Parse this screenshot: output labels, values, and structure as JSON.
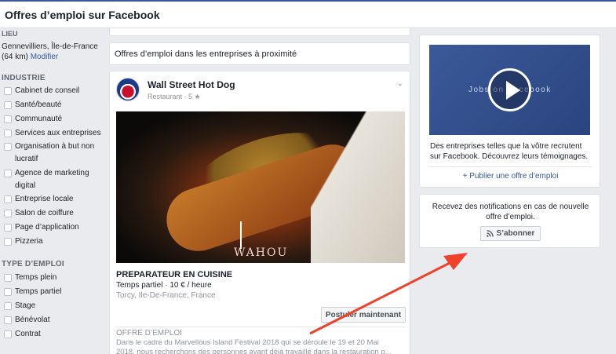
{
  "header": {
    "title": "Offres d’emploi sur Facebook"
  },
  "sidebar": {
    "location_heading": "LIEU",
    "location_text": "Gennevilliers, Île-de-France (64 km)",
    "location_link": "Modifier",
    "industry_heading": "INDUSTRIE",
    "industries": [
      "Cabinet de conseil",
      "Santé/beauté",
      "Communauté",
      "Services aux entreprises",
      "Organisation à but non lucratif",
      "Agence de marketing digital",
      "Entreprise locale",
      "Salon de coiffure",
      "Page d’application",
      "Pizzeria"
    ],
    "type_heading": "TYPE D’EMPLOI",
    "types": [
      "Temps plein",
      "Temps partiel",
      "Stage",
      "Bénévolat",
      "Contrat"
    ]
  },
  "main": {
    "nearby_heading": "Offres d’emploi dans les entreprises à proximité",
    "job": {
      "business_name": "Wall Street Hot Dog",
      "business_meta": "Restaurant · 5 ★",
      "image_watermark": "WAHOU",
      "title": "PREPARATEUR EN CUISINE",
      "meta": "Temps partiel · 10 € / heure",
      "location": "Torcy, Ile-De-France, France",
      "apply_label": "Postuler maintenant",
      "offer_heading": "OFFRE D’EMPLOI",
      "offer_text": "Dans le cadre du Marvellous Island Festival 2018 qui se déroule le 19 et 20 Mai 2018, nous recherchons des personnes ayant déjà travaillé dans la restauration p..."
    }
  },
  "right": {
    "video_overlay": "Jobs on Facebook",
    "promo_text": "Des entreprises telles que la vôtre recrutent sur Facebook. Découvrez leurs témoignages.",
    "publish_label": "+ Publier une offre d’emploi",
    "notif_text": "Recevez des notifications en cas de nouvelle offre d’emploi.",
    "subscribe_label": "S’abonner"
  },
  "colors": {
    "brand": "#3b5998",
    "link": "#385898",
    "annotation_arrow": "#f0412a"
  }
}
